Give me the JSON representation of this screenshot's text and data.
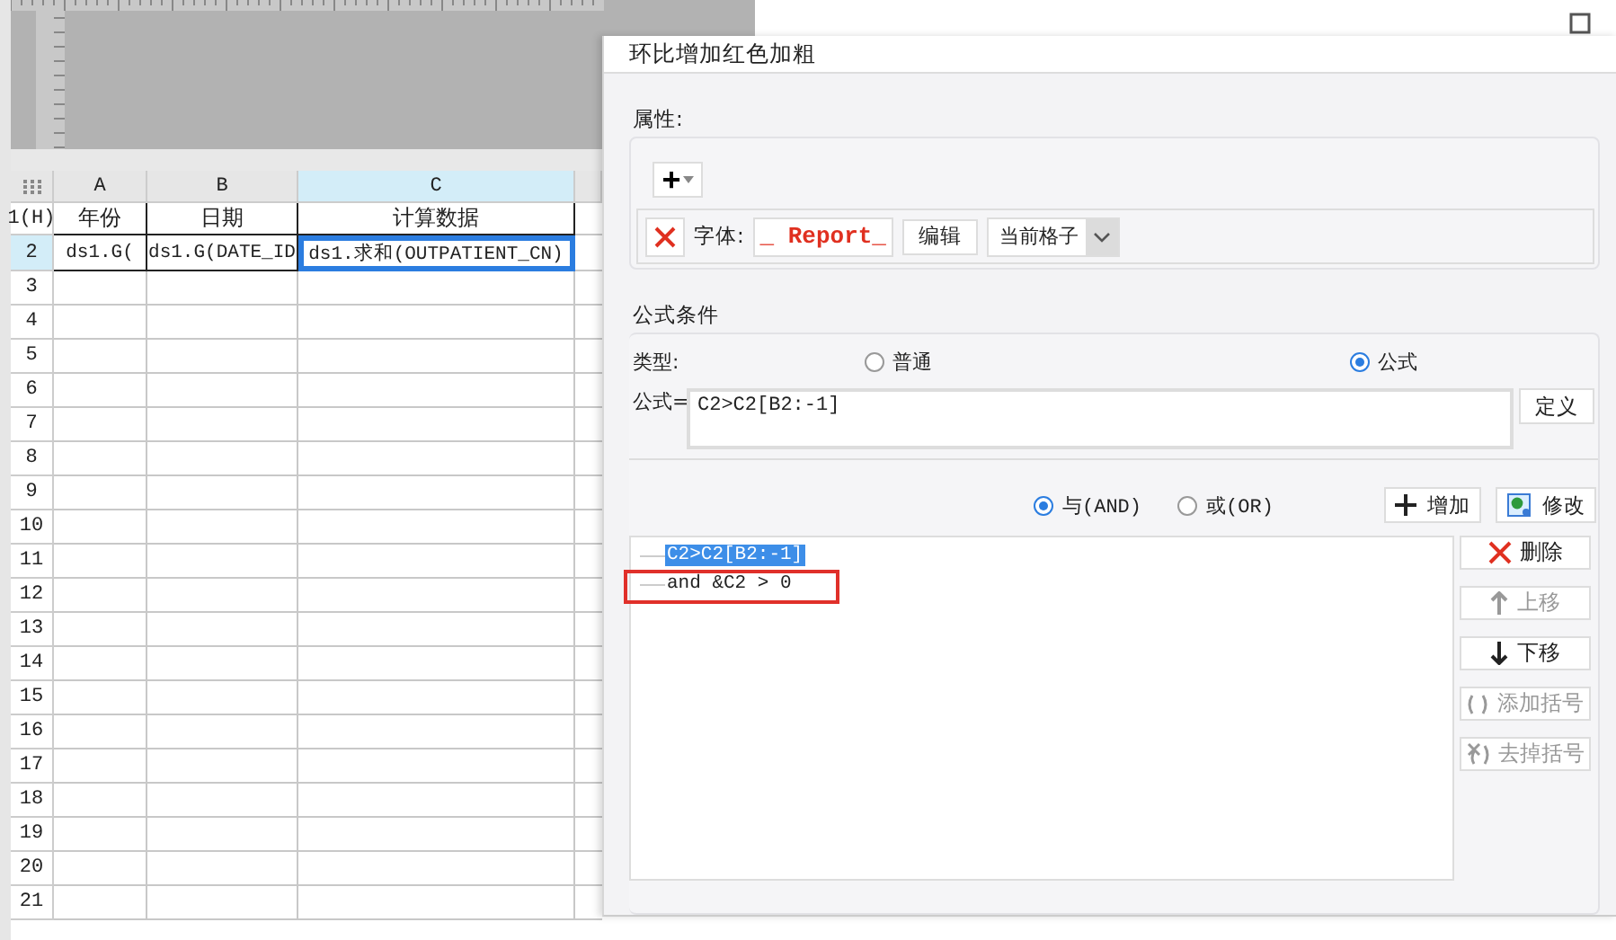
{
  "sheet": {
    "columns": [
      {
        "label": "A",
        "selected": false
      },
      {
        "label": "B",
        "selected": false
      },
      {
        "label": "C",
        "selected": true
      }
    ],
    "rows": [
      {
        "label": "1(H)",
        "selected": false,
        "cells": [
          {
            "text": "年份",
            "selected": false
          },
          {
            "text": "日期",
            "selected": false
          },
          {
            "text": "计算数据",
            "selected": false
          }
        ]
      },
      {
        "label": "2",
        "selected": true,
        "cells": [
          {
            "text": "ds1.G(",
            "selected": false
          },
          {
            "text": "ds1.G(DATE_ID",
            "selected": false
          },
          {
            "text": "ds1.求和(OUTPATIENT_CN)",
            "selected": true
          }
        ]
      },
      {
        "label": "3",
        "selected": false
      },
      {
        "label": "4",
        "selected": false
      },
      {
        "label": "5",
        "selected": false
      },
      {
        "label": "6",
        "selected": false
      },
      {
        "label": "7",
        "selected": false
      },
      {
        "label": "8",
        "selected": false
      },
      {
        "label": "9",
        "selected": false
      },
      {
        "label": "10",
        "selected": false
      },
      {
        "label": "11",
        "selected": false
      },
      {
        "label": "12",
        "selected": false
      },
      {
        "label": "13",
        "selected": false
      },
      {
        "label": "14",
        "selected": false
      },
      {
        "label": "15",
        "selected": false
      },
      {
        "label": "16",
        "selected": false
      },
      {
        "label": "17",
        "selected": false
      },
      {
        "label": "18",
        "selected": false
      },
      {
        "label": "19",
        "selected": false
      },
      {
        "label": "20",
        "selected": false
      },
      {
        "label": "21",
        "selected": false
      }
    ]
  },
  "dialog": {
    "title": "环比增加红色加粗",
    "properties": {
      "label": "属性:",
      "add_button": "+",
      "font_label": "字体:",
      "font_preview": "_ Report_",
      "edit_button": "编辑",
      "scope": "当前格子"
    },
    "condition": {
      "label": "公式条件",
      "type_label": "类型:",
      "types": [
        {
          "label": "普通",
          "selected": false
        },
        {
          "label": "公式",
          "selected": true
        }
      ],
      "formula_label": "公式=",
      "formula": "C2>C2[B2:-1]",
      "define_button": "定义",
      "logic": [
        {
          "label": "与(AND)",
          "selected": true
        },
        {
          "label": "或(OR)",
          "selected": false
        }
      ],
      "add_button": "增加",
      "modify_button": "修改",
      "items": [
        {
          "text": "C2>C2[B2:-1]",
          "selected": true,
          "highlighted": false
        },
        {
          "text": "and &C2 > 0",
          "selected": false,
          "highlighted": true
        }
      ],
      "actions": [
        {
          "kind": "delete",
          "label": "删除",
          "disabled": false
        },
        {
          "kind": "up",
          "label": "上移",
          "disabled": true
        },
        {
          "kind": "down",
          "label": "下移",
          "disabled": false
        },
        {
          "kind": "add-paren",
          "label": "添加括号",
          "disabled": true
        },
        {
          "kind": "remove-paren",
          "label": "去掉括号",
          "disabled": true
        }
      ]
    }
  }
}
